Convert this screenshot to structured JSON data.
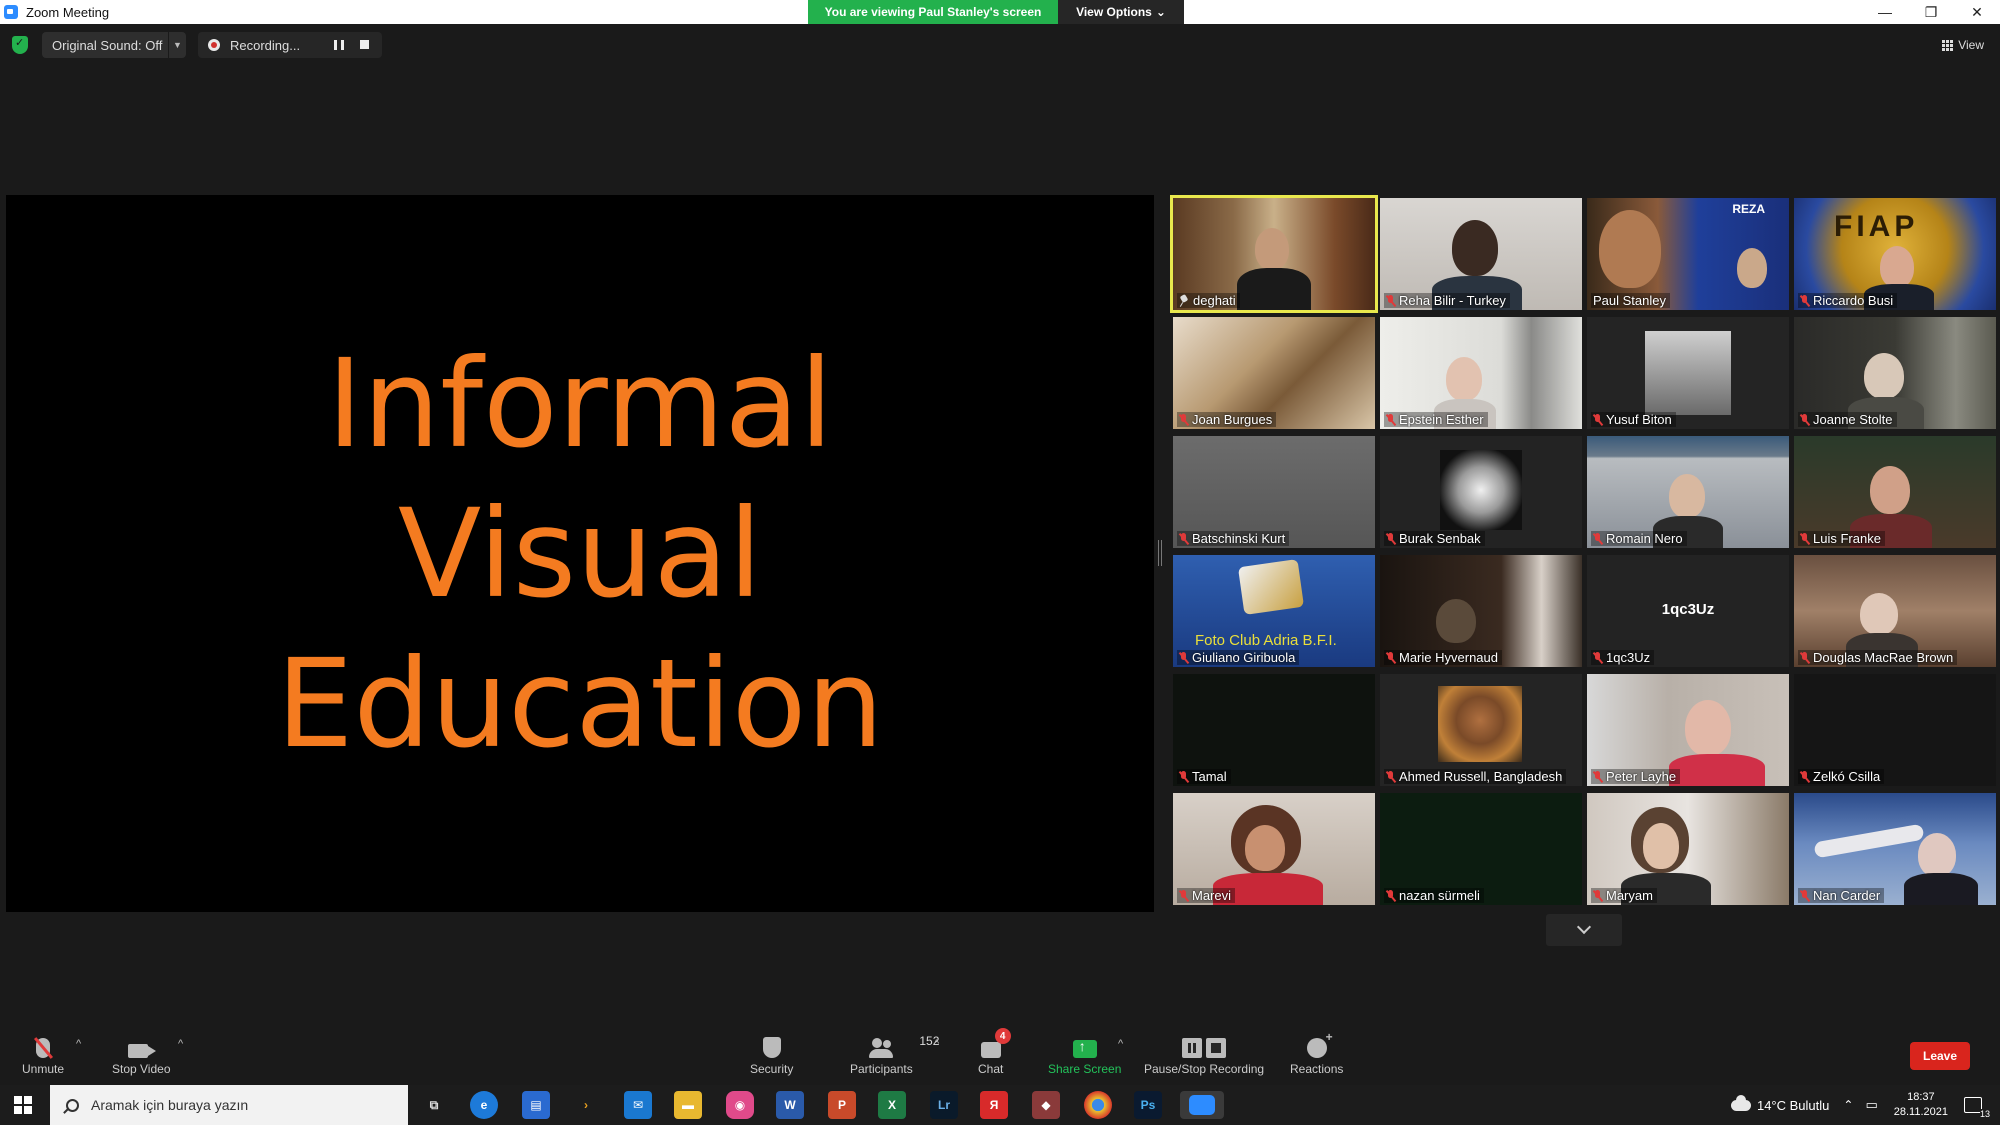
{
  "window": {
    "title": "Zoom Meeting",
    "viewing_banner": "You are viewing Paul Stanley's screen",
    "view_options": "View Options",
    "controls": [
      "—",
      "❐",
      "✕"
    ]
  },
  "topbar": {
    "original_sound": "Original Sound: Off",
    "recording": "Recording...",
    "view": "View"
  },
  "shared_screen": {
    "lines": [
      "Informal",
      "Visual",
      "Education"
    ],
    "text_color": "#f47b20"
  },
  "participants": [
    {
      "name": "deghati",
      "muted": false,
      "pinned": true,
      "active": true
    },
    {
      "name": "Reha Bilir - Turkey",
      "muted": true
    },
    {
      "name": "Paul Stanley",
      "muted": false,
      "overlay": "REZA"
    },
    {
      "name": "Riccardo Busi",
      "muted": true,
      "overlay": "FIAP"
    },
    {
      "name": "Joan Burgues",
      "muted": true
    },
    {
      "name": "Epstein Esther",
      "muted": true
    },
    {
      "name": "Yusuf Biton",
      "muted": true
    },
    {
      "name": "Joanne Stolte",
      "muted": true
    },
    {
      "name": "Batschinski Kurt",
      "muted": true
    },
    {
      "name": "Burak Senbak",
      "muted": true
    },
    {
      "name": "Romain Nero",
      "muted": true
    },
    {
      "name": "Luis Franke",
      "muted": true
    },
    {
      "name": "Giuliano Giribuola",
      "muted": true,
      "overlay": "Foto Club Adria B.F.I."
    },
    {
      "name": "Marie Hyvernaud",
      "muted": true
    },
    {
      "name": "1qc3Uz",
      "muted": true,
      "overlay": "1qc3Uz"
    },
    {
      "name": "Douglas MacRae Brown",
      "muted": true
    },
    {
      "name": "Tamal",
      "muted": true
    },
    {
      "name": "Ahmed Russell, Bangladesh",
      "muted": true
    },
    {
      "name": "Peter Layhe",
      "muted": true
    },
    {
      "name": "Zelkó Csilla",
      "muted": true
    },
    {
      "name": "Marevi",
      "muted": true
    },
    {
      "name": "nazan sürmeli",
      "muted": true
    },
    {
      "name": "Maryam",
      "muted": true
    },
    {
      "name": "Nan Carder",
      "muted": true
    }
  ],
  "toolbar": {
    "unmute": "Unmute",
    "stop_video": "Stop Video",
    "security": "Security",
    "participants": "Participants",
    "participants_count": "152",
    "chat": "Chat",
    "chat_badge": "4",
    "share_screen": "Share Screen",
    "pause_stop_recording": "Pause/Stop Recording",
    "reactions": "Reactions",
    "leave": "Leave"
  },
  "taskbar": {
    "search_placeholder": "Aramak için buraya yazın",
    "weather": "14°C  Bulutlu",
    "time": "18:37",
    "date": "28.11.2021",
    "notifications": "13",
    "apps": [
      "task-view",
      "edge",
      "store",
      "more",
      "mail",
      "explorer",
      "photos",
      "word",
      "powerpoint",
      "excel",
      "lightroom",
      "yandex",
      "app",
      "chrome",
      "photoshop",
      "zoom"
    ]
  }
}
